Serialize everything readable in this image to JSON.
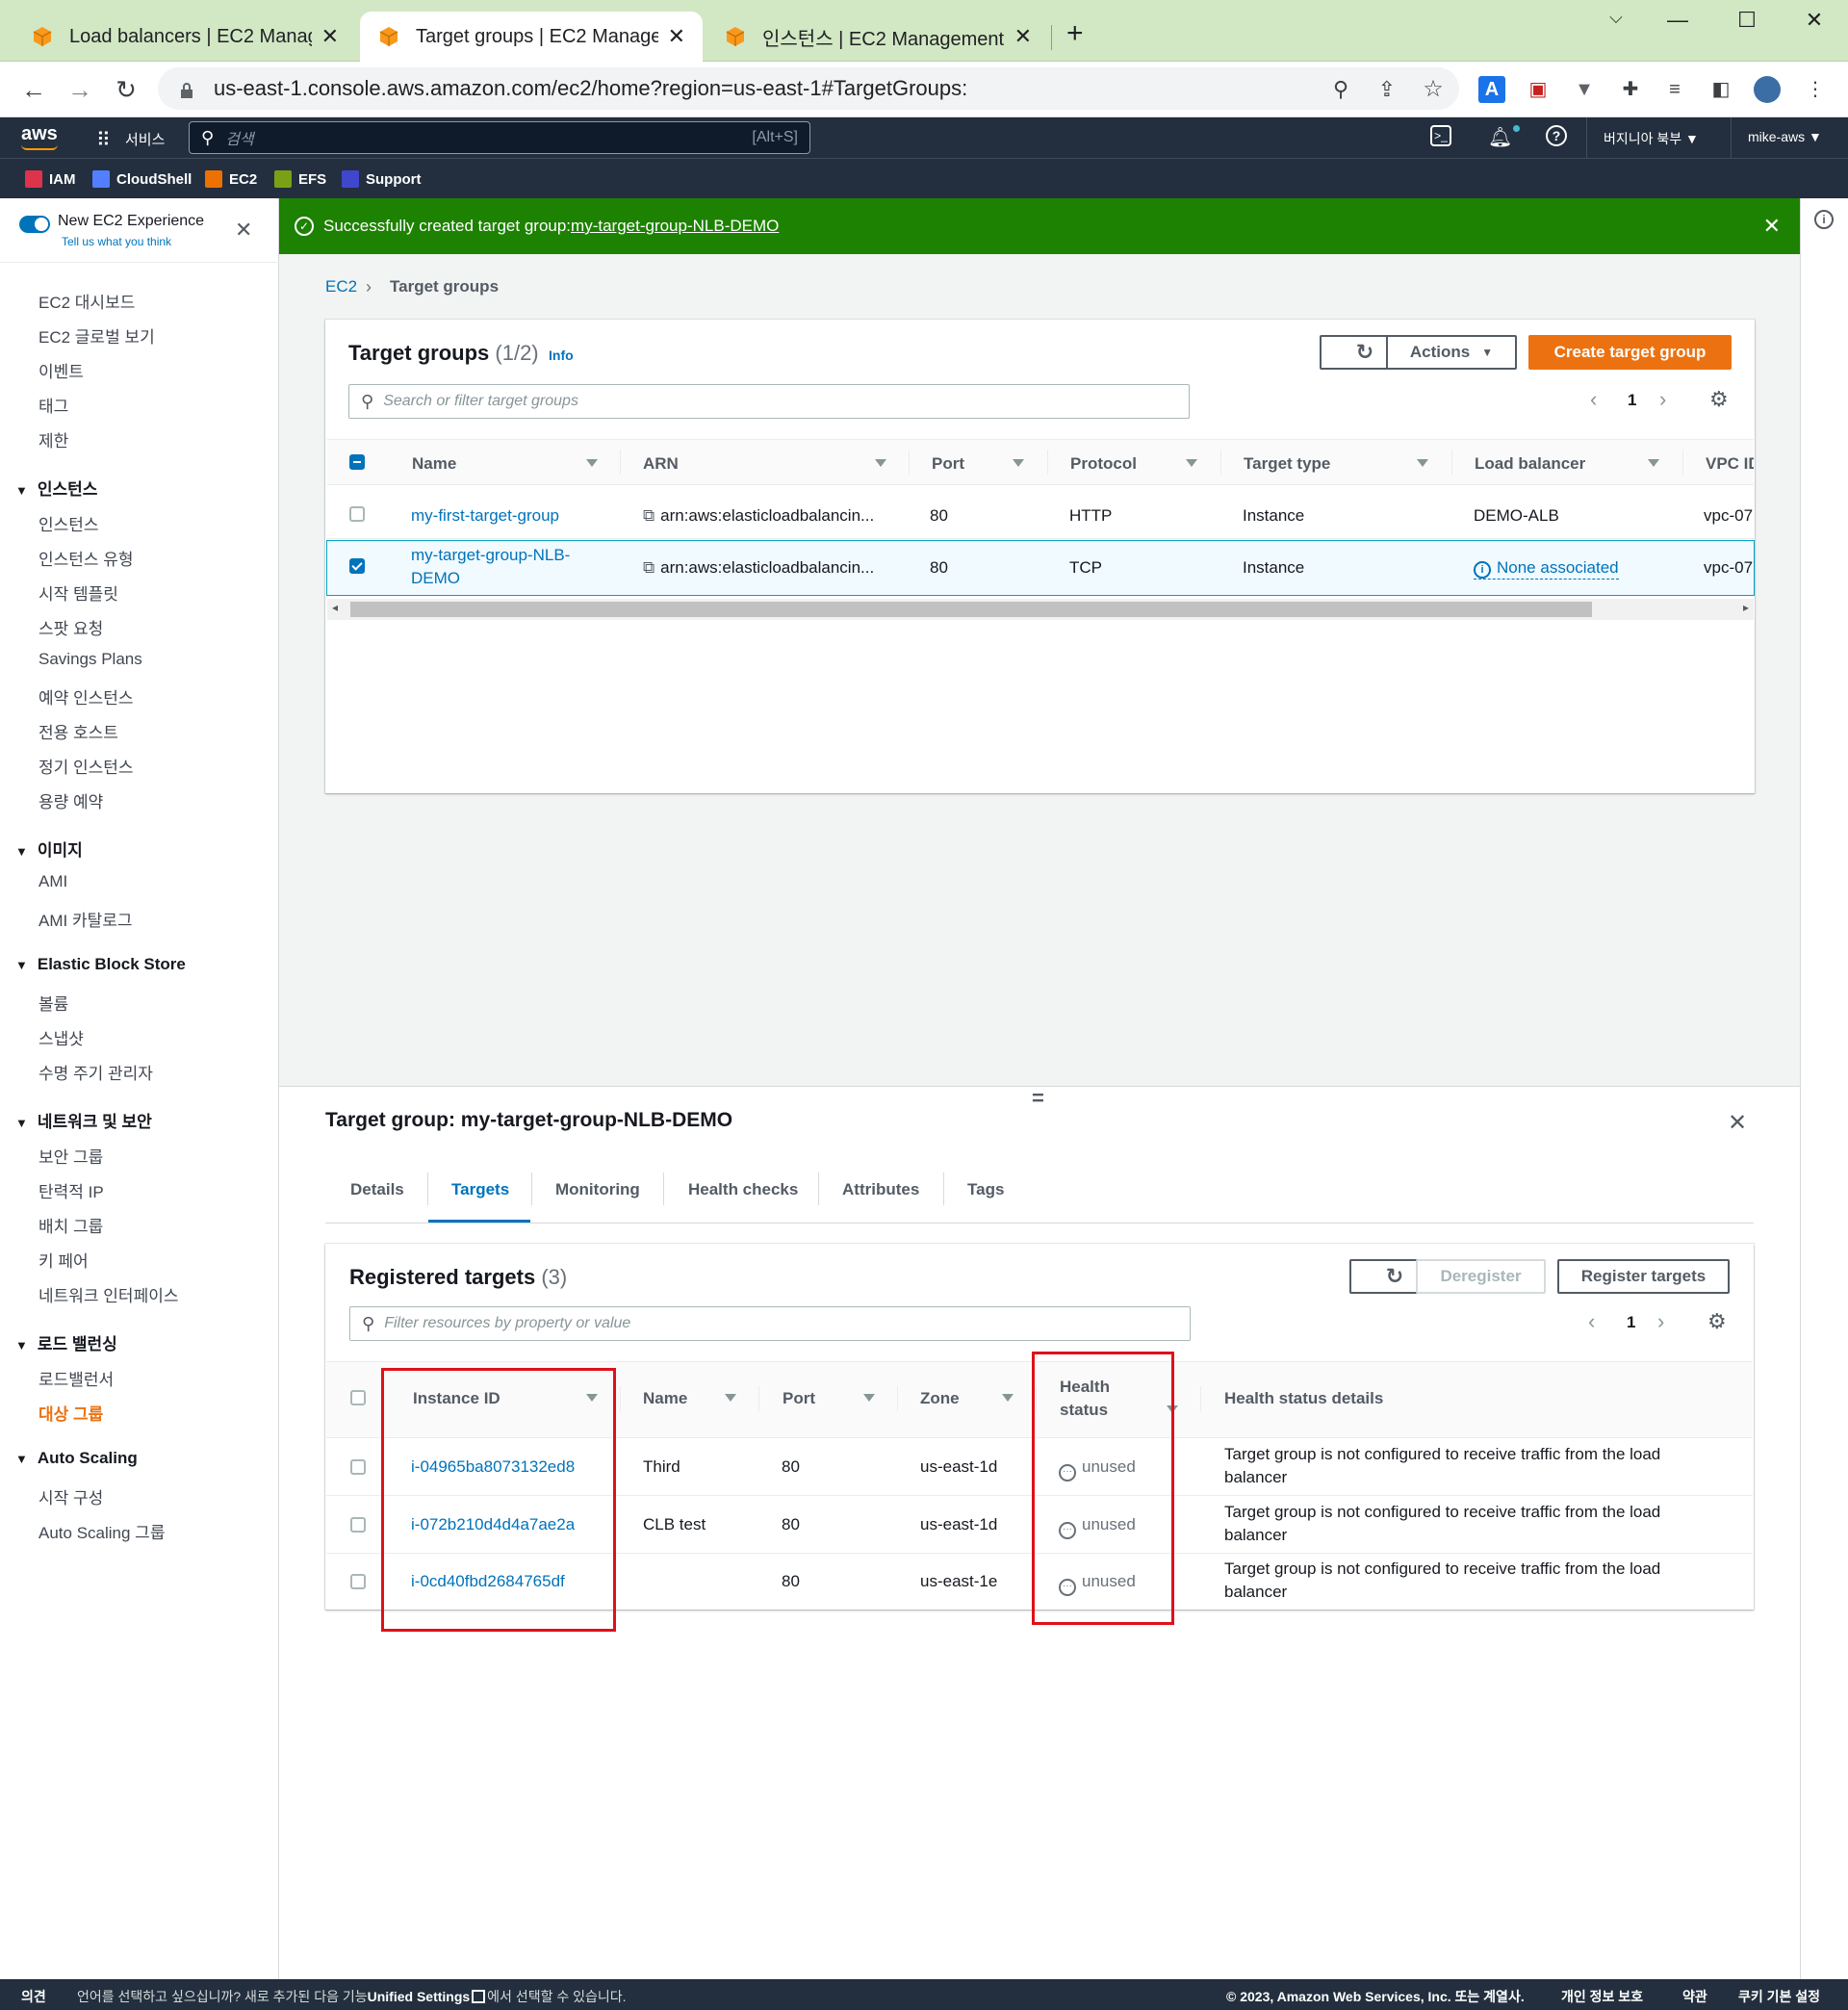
{
  "browser": {
    "tabs": [
      {
        "title": "Load balancers | EC2 Management Console",
        "close": "✕"
      },
      {
        "title": "Target groups | EC2 Management Console",
        "close": "✕"
      },
      {
        "title": "인스턴스 | EC2 Management Console",
        "close": "✕"
      }
    ],
    "new_tab": "+",
    "url": "us-east-1.console.aws.amazon.com/ec2/home?region=us-east-1#TargetGroups:"
  },
  "aws_nav": {
    "logo": "aws",
    "services": "서비스",
    "search_placeholder": "검색",
    "search_shortcut": "[Alt+S]",
    "region": "버지니아 북부 ▼",
    "account": "mike-aws ▼",
    "favorites": [
      "IAM",
      "CloudShell",
      "EC2",
      "EFS",
      "Support"
    ],
    "favorite_colors": [
      "#dd344c",
      "#527fff",
      "#ed7100",
      "#7aa116",
      "#3f48cc"
    ]
  },
  "sidebar": {
    "experience_title": "New EC2 Experience",
    "experience_sub": "Tell us what you think",
    "top_items": [
      "EC2 대시보드",
      "EC2 글로벌 보기",
      "이벤트",
      "태그",
      "제한"
    ],
    "sections": [
      {
        "title": "인스턴스",
        "items": [
          "인스턴스",
          "인스턴스 유형",
          "시작 템플릿",
          "스팟 요청",
          "Savings Plans",
          "예약 인스턴스",
          "전용 호스트",
          "정기 인스턴스",
          "용량 예약"
        ]
      },
      {
        "title": "이미지",
        "items": [
          "AMI",
          "AMI 카탈로그"
        ]
      },
      {
        "title": "Elastic Block Store",
        "items": [
          "볼륨",
          "스냅샷",
          "수명 주기 관리자"
        ]
      },
      {
        "title": "네트워크 및 보안",
        "items": [
          "보안 그룹",
          "탄력적 IP",
          "배치 그룹",
          "키 페어",
          "네트워크 인터페이스"
        ]
      },
      {
        "title": "로드 밸런싱",
        "items": [
          "로드밸런서",
          "대상 그룹"
        ]
      },
      {
        "title": "Auto Scaling",
        "items": [
          "시작 구성",
          "Auto Scaling 그룹"
        ]
      }
    ]
  },
  "flash": {
    "text": "Successfully created target group: ",
    "link": "my-target-group-NLB-DEMO"
  },
  "breadcrumb": {
    "root": "EC2",
    "current": "Target groups"
  },
  "target_groups": {
    "title": "Target groups",
    "count": "(1/2)",
    "info": "Info",
    "actions": "Actions",
    "create": "Create target group",
    "search_placeholder": "Search or filter target groups",
    "page": "1",
    "columns": [
      "Name",
      "ARN",
      "Port",
      "Protocol",
      "Target type",
      "Load balancer",
      "VPC ID"
    ],
    "rows": [
      {
        "name": "my-first-target-group",
        "arn": "arn:aws:elasticloadbalancin...",
        "port": "80",
        "protocol": "HTTP",
        "target_type": "Instance",
        "lb": "DEMO-ALB",
        "vpc": "vpc-07"
      },
      {
        "name_line1": "my-target-group-NLB-",
        "name_line2": "DEMO",
        "arn": "arn:aws:elasticloadbalancin...",
        "port": "80",
        "protocol": "TCP",
        "target_type": "Instance",
        "lb": "None associated",
        "vpc": "vpc-07"
      }
    ]
  },
  "detail": {
    "title": "Target group: my-target-group-NLB-DEMO",
    "tabs": [
      "Details",
      "Targets",
      "Monitoring",
      "Health checks",
      "Attributes",
      "Tags"
    ],
    "active_tab": "Targets",
    "registered_title": "Registered targets",
    "registered_count": "(3)",
    "deregister": "Deregister",
    "register": "Register targets",
    "filter_placeholder": "Filter resources by property or value",
    "page": "1",
    "columns": {
      "instance_id": "Instance ID",
      "name": "Name",
      "port": "Port",
      "zone": "Zone",
      "health_line1": "Health",
      "health_line2": "status",
      "health_details": "Health status details"
    },
    "rows": [
      {
        "id": "i-04965ba8073132ed8",
        "name": "Third",
        "port": "80",
        "zone": "us-east-1d",
        "health": "unused",
        "details1": "Target group is not configured to receive traffic from the load",
        "details2": "balancer"
      },
      {
        "id": "i-072b210d4d4a7ae2a",
        "name": "CLB test",
        "port": "80",
        "zone": "us-east-1d",
        "health": "unused",
        "details1": "Target group is not configured to receive traffic from the load",
        "details2": "balancer"
      },
      {
        "id": "i-0cd40fbd2684765df",
        "name": "",
        "port": "80",
        "zone": "us-east-1e",
        "health": "unused",
        "details1": "Target group is not configured to receive traffic from the load",
        "details2": "balancer"
      }
    ]
  },
  "footer": {
    "feedback": "의견",
    "lang_prefix": "언어를 선택하고 싶으십니까? 새로 추가된 다음 기능",
    "lang_link": "Unified Settings",
    "lang_suffix": "에서 선택할 수 있습니다.",
    "copyright": "© 2023, Amazon Web Services, Inc. 또는 계열사.",
    "privacy": "개인 정보 보호",
    "terms": "약관",
    "cookies": "쿠키 기본 설정"
  }
}
